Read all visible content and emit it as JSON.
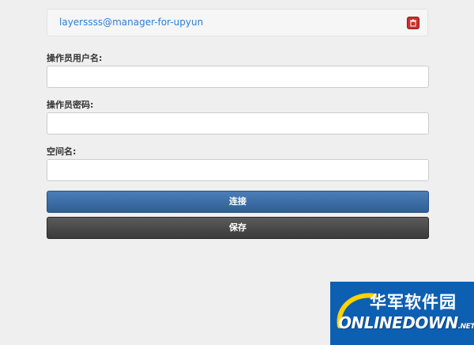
{
  "account": {
    "name": "layerssss@manager-for-upyun"
  },
  "form": {
    "operator_label": "操作员用户名:",
    "operator_value": "",
    "password_label": "操作员密码:",
    "password_value": "",
    "bucket_label": "空间名:",
    "bucket_value": ""
  },
  "buttons": {
    "connect_label": "连接",
    "save_label": "保存"
  },
  "watermark": {
    "title": "华军软件园",
    "brand": "ONLINEDOWN",
    "suffix": ".NET"
  },
  "colors": {
    "background": "#efefef",
    "link": "#2a7fd4",
    "connect_button": "#3a6aa3",
    "save_button": "#4a4a4a",
    "delete_button": "#c9302c",
    "watermark_bg": "#0d5fb2"
  }
}
